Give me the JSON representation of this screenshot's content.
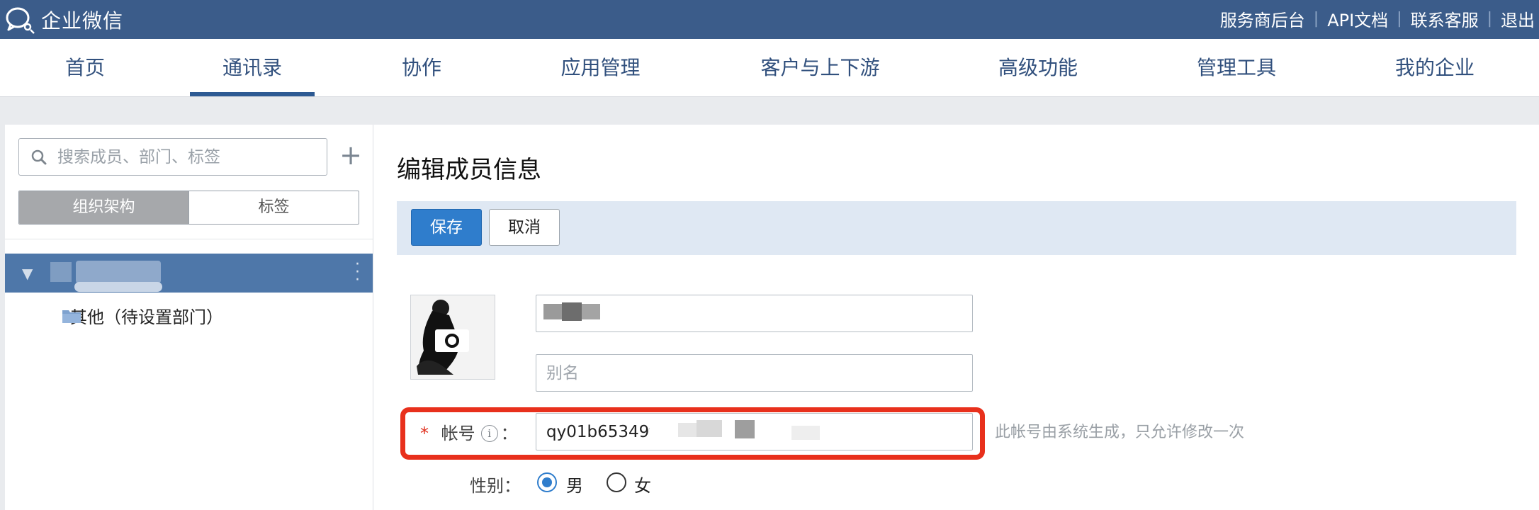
{
  "app": {
    "name": "企业微信"
  },
  "top_links": [
    "服务商后台",
    "API文档",
    "联系客服",
    "退出"
  ],
  "nav": {
    "items": [
      "首页",
      "通讯录",
      "协作",
      "应用管理",
      "客户与上下游",
      "高级功能",
      "管理工具",
      "我的企业"
    ],
    "active": "通讯录"
  },
  "sidebar": {
    "search_placeholder": "搜索成员、部门、标签",
    "add_label": "+",
    "tabs": [
      "组织架构",
      "标签"
    ],
    "active_tab": "组织架构",
    "tree": [
      {
        "label": "",
        "selected": true,
        "redacted": true
      },
      {
        "label": "其他（待设置部门）",
        "selected": false
      }
    ]
  },
  "form": {
    "title": "编辑成员信息",
    "save_label": "保存",
    "cancel_label": "取消",
    "name_value": "",
    "alias_placeholder": "别名",
    "account": {
      "required_mark": "*",
      "label": "帐号",
      "info_glyph": "i",
      "colon": "：",
      "value": "qy01b65349f8",
      "hint": "此帐号由系统生成，只允许修改一次"
    },
    "gender": {
      "label": "性别：",
      "options": [
        "男",
        "女"
      ],
      "selected": "男"
    }
  },
  "colors": {
    "topbar": "#3b5c8a",
    "primary_button": "#2f7dcc",
    "highlight_box": "#e8301c",
    "selected_row": "#4e77a9"
  }
}
